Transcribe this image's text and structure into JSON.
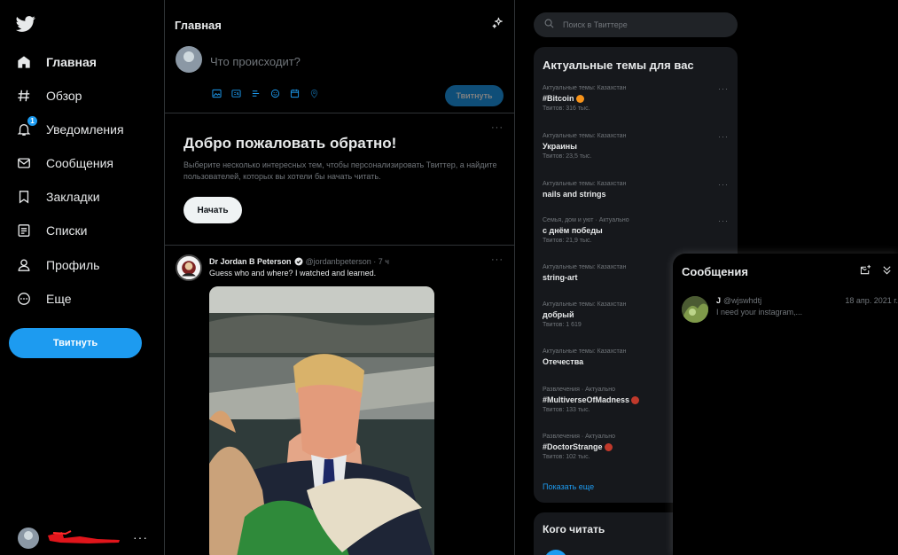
{
  "sidebar": {
    "items": [
      {
        "label": "Главная",
        "icon": "home-icon",
        "active": true
      },
      {
        "label": "Обзор",
        "icon": "hashtag-icon"
      },
      {
        "label": "Уведомления",
        "icon": "bell-icon",
        "badge": "1"
      },
      {
        "label": "Сообщения",
        "icon": "envelope-icon"
      },
      {
        "label": "Закладки",
        "icon": "bookmark-icon"
      },
      {
        "label": "Списки",
        "icon": "list-icon"
      },
      {
        "label": "Профиль",
        "icon": "person-icon"
      },
      {
        "label": "Еще",
        "icon": "more-circle-icon"
      }
    ],
    "tweet_button": "Твитнуть",
    "account_more": "···"
  },
  "main": {
    "title": "Главная",
    "composer": {
      "placeholder": "Что происходит?",
      "tweet_button": "Твитнуть"
    },
    "welcome": {
      "title": "Добро пожаловать обратно!",
      "text": "Выберите несколько интересных тем, чтобы персонализировать Твиттер, а найдите пользователей, которых вы хотели бы начать читать.",
      "button": "Начать",
      "more": "···"
    },
    "tweet": {
      "name": "Dr Jordan B Peterson",
      "handle": "@jordanbpeterson · 7 ч",
      "text": "Guess who and where? I watched and learned.",
      "more": "···"
    }
  },
  "search": {
    "placeholder": "Поиск в Твиттере"
  },
  "trends": {
    "title": "Актуальные темы для вас",
    "items": [
      {
        "context": "Актуальные темы: Казахстан",
        "title": "#Bitcoin",
        "count": "Твитов: 316 тыс.",
        "emoji": "#f7931a"
      },
      {
        "context": "Актуальные темы: Казахстан",
        "title": "Украины",
        "count": "Твитов: 23,5 тыс."
      },
      {
        "context": "Актуальные темы: Казахстан",
        "title": "nails and strings",
        "count": ""
      },
      {
        "context": "Семья, дом и уют · Актуально",
        "title": "с днём победы",
        "count": "Твитов: 21,9 тыс."
      },
      {
        "context": "Актуальные темы: Казахстан",
        "title": "string-art",
        "count": ""
      },
      {
        "context": "Актуальные темы: Казахстан",
        "title": "добрый",
        "count": "Твитов: 1 619"
      },
      {
        "context": "Актуальные темы: Казахстан",
        "title": "Отечества",
        "count": ""
      },
      {
        "context": "Развлечения · Актуально",
        "title": "#MultiverseOfMadness",
        "count": "Твитов: 133 тыс.",
        "emoji": "#c0392b"
      },
      {
        "context": "Развлечения · Актуально",
        "title": "#DoctorStrange",
        "count": "Твитов: 102 тыс.",
        "emoji": "#c0392b"
      }
    ],
    "show_more": "Показать еще",
    "more": "···"
  },
  "who_to_follow": {
    "title": "Кого читать"
  },
  "messages": {
    "title": "Сообщения",
    "conversations": [
      {
        "name": "J",
        "handle": "@wjswhdtj",
        "date": "18 апр. 2021 г.",
        "preview": "I need your instagram,..."
      }
    ]
  },
  "colors": {
    "accent": "#1d9bf0",
    "background": "#000000",
    "panel": "#16181c",
    "muted": "#71767b"
  }
}
